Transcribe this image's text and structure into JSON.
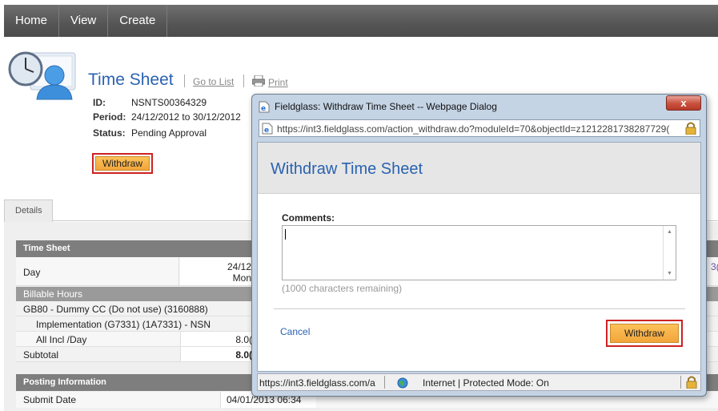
{
  "nav": {
    "items": [
      "Home",
      "View",
      "Create"
    ]
  },
  "header": {
    "title": "Time Sheet",
    "go_to_list": "Go to List",
    "print": "Print"
  },
  "meta": {
    "id_label": "ID:",
    "id_value": "NSNTS00364329",
    "period_label": "Period:",
    "period_value": "24/12/2012 to 30/12/2012",
    "status_label": "Status:",
    "status_value": "Pending Approval"
  },
  "withdraw_button": "Withdraw",
  "tabs": {
    "details": "Details"
  },
  "timesheet": {
    "section_title": "Time Sheet",
    "day_label": "Day",
    "day_col_date": "24/12",
    "day_col_dow": "Mon",
    "right_edge_value": "3(",
    "billable_hours": "Billable Hours",
    "cost_center": "GB80 - Dummy CC (Do not use) (3160888)",
    "implementation": "Implementation (G7331) (1A7331) - NSN",
    "all_incl_label": "All Incl /Day",
    "all_incl_value": "8.0(",
    "subtotal_label": "Subtotal",
    "subtotal_value": "8.0("
  },
  "posting": {
    "section_title": "Posting Information",
    "submit_date_label": "Submit Date",
    "submit_date_value": "04/01/2013 06:34"
  },
  "dialog": {
    "window_title": "Fieldglass: Withdraw Time Sheet -- Webpage Dialog",
    "close_glyph": "x",
    "url": "https://int3.fieldglass.com/action_withdraw.do?moduleId=70&objectId=z1212281738287729(",
    "heading": "Withdraw Time Sheet",
    "comments_label": "Comments:",
    "comments_value": "",
    "chars_remaining": "(1000 characters remaining)",
    "cancel": "Cancel",
    "withdraw": "Withdraw",
    "status_url": "https://int3.fieldglass.com/a",
    "status_zone": "Internet | Protected Mode: On"
  },
  "colors": {
    "accent_blue": "#2a62b0",
    "button_orange": "#f2a53a",
    "highlight_red": "#cc2222"
  },
  "icons": [
    "timesheet-clock-user-icon",
    "printer-icon",
    "ie-page-icon",
    "lock-icon",
    "globe-icon"
  ]
}
